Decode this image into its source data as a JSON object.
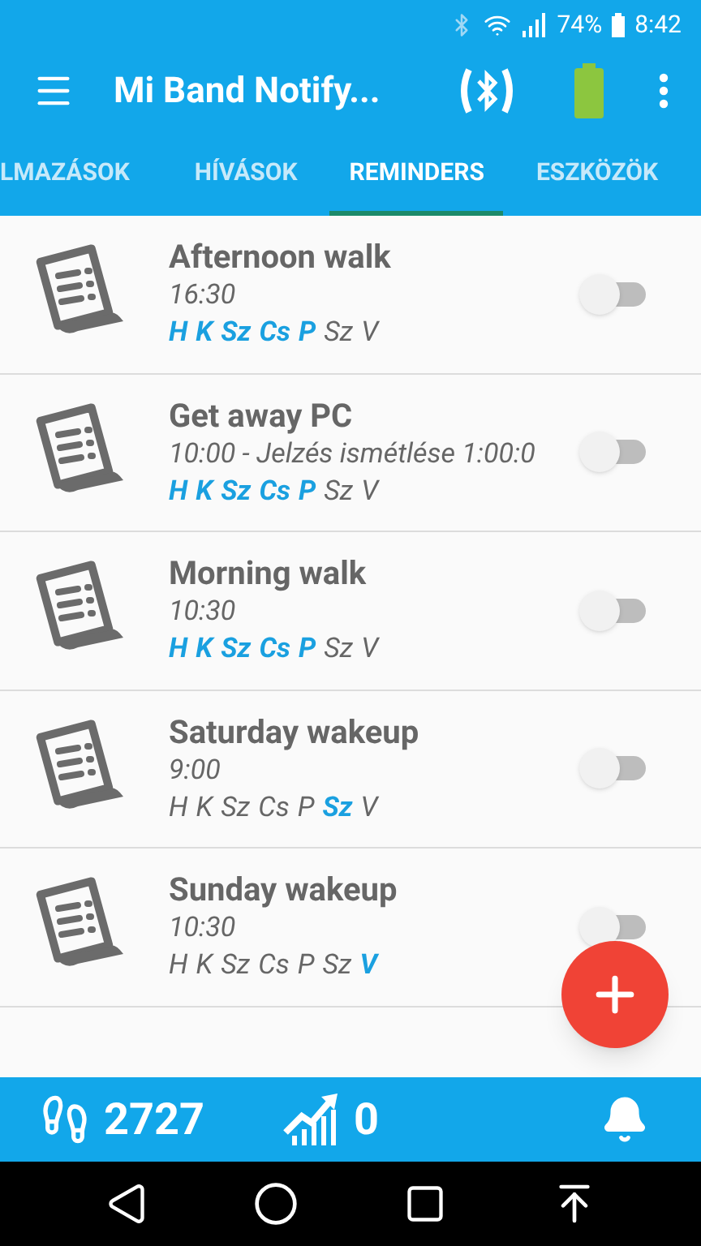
{
  "status_bar": {
    "battery": "74%",
    "time": "8:42"
  },
  "app_bar": {
    "title": "Mi Band Notify..."
  },
  "tabs": [
    {
      "label": "LMAZÁSOK",
      "selected": false
    },
    {
      "label": "HÍVÁSOK",
      "selected": false
    },
    {
      "label": "REMINDERS",
      "selected": true
    },
    {
      "label": "ESZKÖZÖK",
      "selected": false
    }
  ],
  "reminders": [
    {
      "title": "Afternoon walk",
      "time": "16:30",
      "on": false,
      "days": [
        {
          "label": "H",
          "on": true
        },
        {
          "label": "K",
          "on": true
        },
        {
          "label": "Sz",
          "on": true
        },
        {
          "label": "Cs",
          "on": true
        },
        {
          "label": "P",
          "on": true
        },
        {
          "label": "Sz",
          "on": false
        },
        {
          "label": "V",
          "on": false
        }
      ]
    },
    {
      "title": "Get away PC",
      "time": "10:00 - Jelzés ismétlése 1:00:0",
      "on": false,
      "days": [
        {
          "label": "H",
          "on": true
        },
        {
          "label": "K",
          "on": true
        },
        {
          "label": "Sz",
          "on": true
        },
        {
          "label": "Cs",
          "on": true
        },
        {
          "label": "P",
          "on": true
        },
        {
          "label": "Sz",
          "on": false
        },
        {
          "label": "V",
          "on": false
        }
      ]
    },
    {
      "title": "Morning walk",
      "time": "10:30",
      "on": false,
      "days": [
        {
          "label": "H",
          "on": true
        },
        {
          "label": "K",
          "on": true
        },
        {
          "label": "Sz",
          "on": true
        },
        {
          "label": "Cs",
          "on": true
        },
        {
          "label": "P",
          "on": true
        },
        {
          "label": "Sz",
          "on": false
        },
        {
          "label": "V",
          "on": false
        }
      ]
    },
    {
      "title": "Saturday wakeup",
      "time": "9:00",
      "on": false,
      "days": [
        {
          "label": "H",
          "on": false
        },
        {
          "label": "K",
          "on": false
        },
        {
          "label": "Sz",
          "on": false
        },
        {
          "label": "Cs",
          "on": false
        },
        {
          "label": "P",
          "on": false
        },
        {
          "label": "Sz",
          "on": true
        },
        {
          "label": "V",
          "on": false
        }
      ]
    },
    {
      "title": "Sunday wakeup",
      "time": "10:30",
      "on": false,
      "days": [
        {
          "label": "H",
          "on": false
        },
        {
          "label": "K",
          "on": false
        },
        {
          "label": "Sz",
          "on": false
        },
        {
          "label": "Cs",
          "on": false
        },
        {
          "label": "P",
          "on": false
        },
        {
          "label": "Sz",
          "on": false
        },
        {
          "label": "V",
          "on": true
        }
      ]
    }
  ],
  "bottom_bar": {
    "steps": "2727",
    "score": "0"
  }
}
